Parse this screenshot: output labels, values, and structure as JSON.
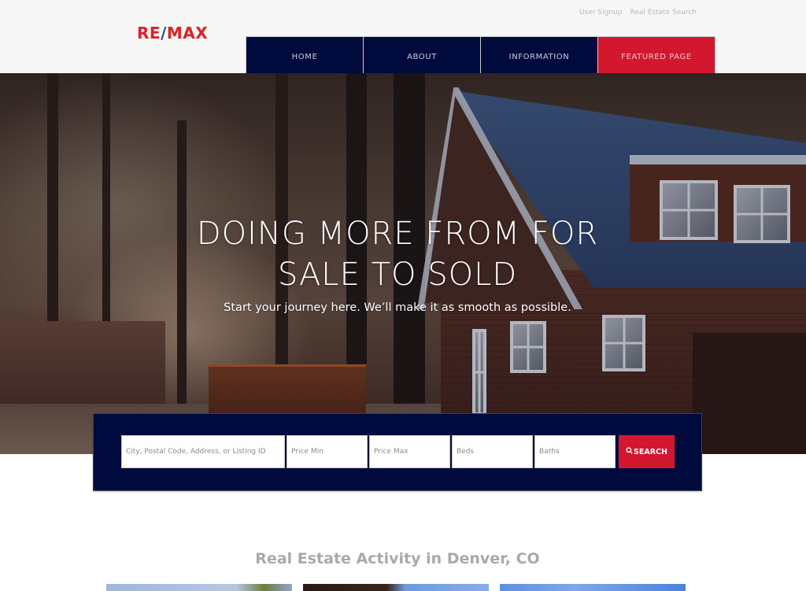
{
  "header": {
    "logo": {
      "part1": "RE",
      "slash": "/",
      "part2": "MAX"
    },
    "util_links": [
      "User Signup",
      "Real Estate Search"
    ],
    "nav": [
      {
        "label": "HOME"
      },
      {
        "label": "ABOUT"
      },
      {
        "label": "INFORMATION"
      },
      {
        "label": "FEATURED PAGE"
      }
    ]
  },
  "hero": {
    "title_line1": "DOING MORE FROM FOR",
    "title_line2": "SALE TO SOLD",
    "subtitle": "Start your journey here. We’ll make it as smooth as possible."
  },
  "search": {
    "location_placeholder": "City, Postal Code, Address, or Listing ID",
    "price_min_placeholder": "Price Min",
    "price_max_placeholder": "Price Max",
    "beds_placeholder": "Beds",
    "baths_placeholder": "Baths",
    "button_label": "SEARCH",
    "button_icon": "search-icon"
  },
  "activity": {
    "title": "Real Estate Activity in Denver, CO",
    "cards": [
      {
        "image": "listing-photo-1"
      },
      {
        "image": "listing-photo-2"
      },
      {
        "image": "listing-photo-3"
      }
    ]
  },
  "colors": {
    "brand_red": "#d3172f",
    "brand_navy": "#000a3c",
    "logo_blue": "#1b4fa0"
  }
}
